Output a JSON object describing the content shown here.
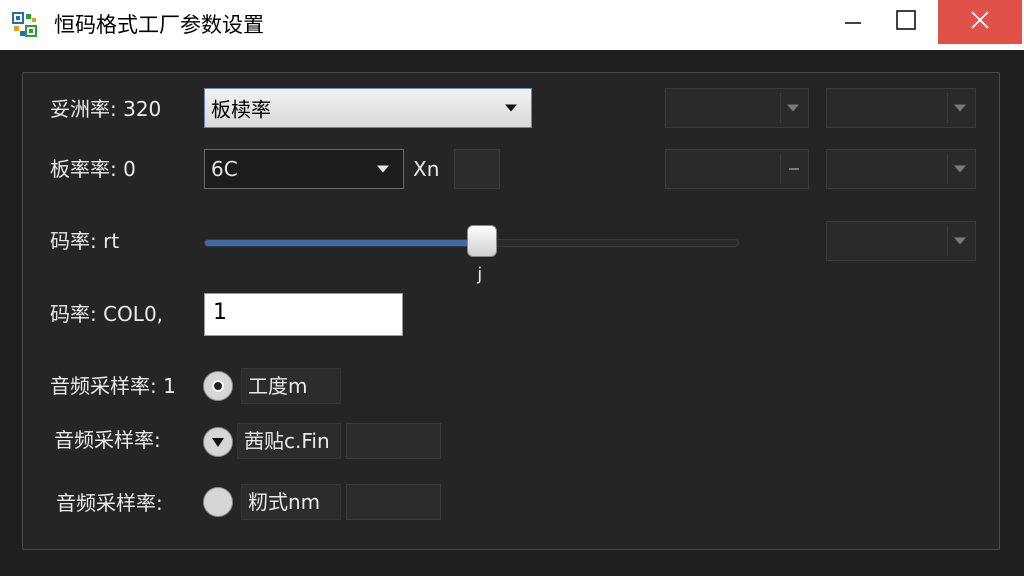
{
  "window": {
    "title": "恒码格式工厂参数设置",
    "icons": {
      "app": "app-icon",
      "minimize": "minimize-icon",
      "maximize": "maximize-icon",
      "close": "close-icon"
    },
    "colors": {
      "close_button": "#e0514a",
      "accent": "#3f6aa8"
    }
  },
  "rows": {
    "row1": {
      "label": "妥洲率: 320",
      "combo_value": "板椟率"
    },
    "row2": {
      "label": "板率率: 0",
      "combo_value": "6C",
      "suffix": "Xn"
    },
    "row3": {
      "label": "码率: rt",
      "slider_value_label": "j",
      "slider_fraction": 0.52
    },
    "row4": {
      "label": "码率: COL0,",
      "input_value": "1"
    },
    "row5": {
      "label": "音频采样率: 1",
      "option_text": "工度m"
    },
    "row6": {
      "label": "音频采样率:",
      "option_text": "茜贴c.Fin"
    },
    "row7": {
      "label": "音频采样率:",
      "option_text": "籾式nm"
    }
  }
}
